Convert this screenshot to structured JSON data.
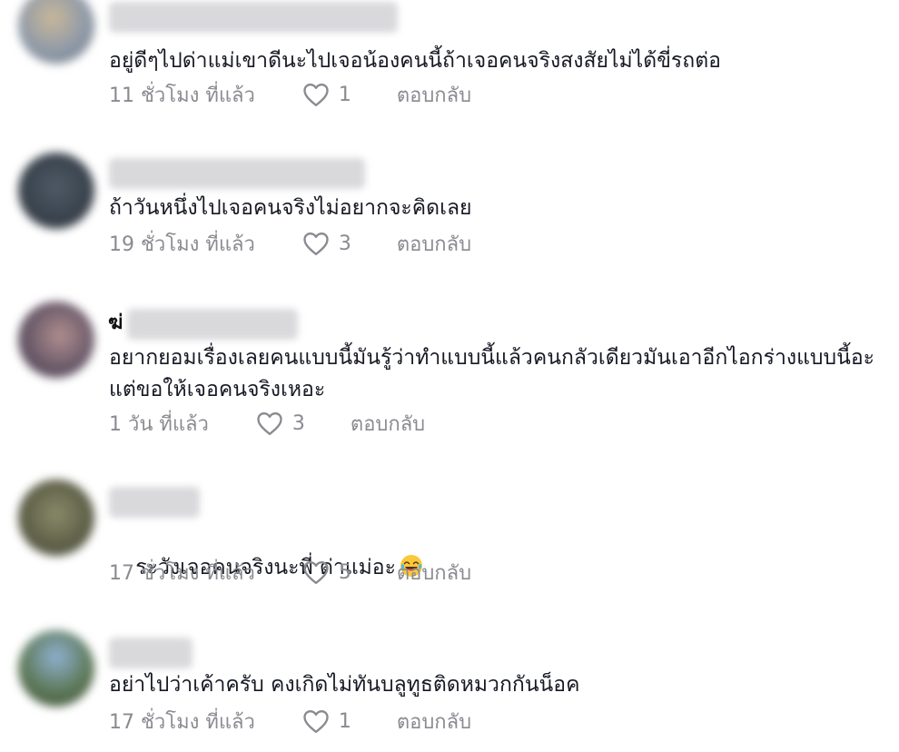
{
  "comments": [
    {
      "text": "อยู่ดีๆไปด่าแม่เขาดีนะไปเจอน้องคนนี้ถ้าเจอคนจริงสงสัยไม่ได้ขี่รถต่อ",
      "time": "11 ชั่วโมง ที่แล้ว",
      "likes": "1",
      "reply": "ตอบกลับ"
    },
    {
      "text": "ถ้าวันหนึ่งไปเจอคนจริงไม่อยากจะคิดเลย",
      "time": "19 ชั่วโมง ที่แล้ว",
      "likes": "3",
      "reply": "ตอบกลับ"
    },
    {
      "username_visible": "ฆ่",
      "text": "อยากยอมเรื่องเลยคนแบบนี้มันรู้ว่าทำแบบนี้แล้วคนกลัวเดียวมันเอาอีกไอกร่างแบบนี้อะแต่ขอให้เจอคนจริงเหอะ",
      "time": "1 วัน ที่แล้ว",
      "likes": "3",
      "reply": "ตอบกลับ"
    },
    {
      "text": "ระวังเจอคนจริงนะพี่ ด่าแม่อะ",
      "emoji": "laughing-tears-emoji",
      "time": "17 ชั่วโมง ที่แล้ว",
      "likes": "5",
      "reply": "ตอบกลับ"
    },
    {
      "text": "อย่าไปว่าเค้าครับ คงเกิดไม่ทันบลูทูธติดหมวกกันน็อค",
      "time": "17 ชั่วโมง ที่แล้ว",
      "likes": "1",
      "reply": "ตอบกลับ"
    }
  ],
  "icons": {
    "like": "heart-outline-icon"
  },
  "colors": {
    "text": "#161823",
    "meta": "#8a8b91",
    "background": "#ffffff"
  }
}
